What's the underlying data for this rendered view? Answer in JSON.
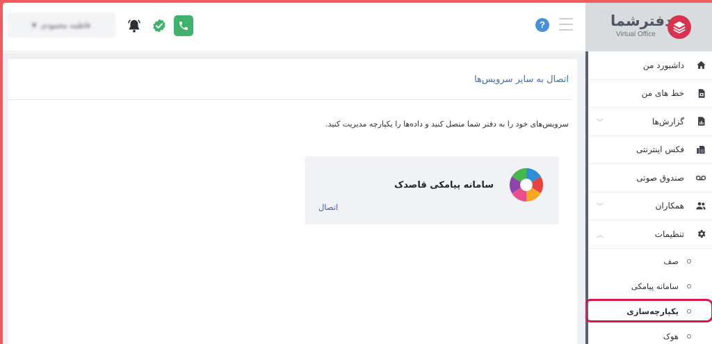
{
  "header": {
    "user_select_value": "فاطمه محمودی",
    "icons": [
      "bell-icon",
      "verified-check-icon",
      "phone-icon",
      "help-icon",
      "menu-icon"
    ]
  },
  "brand": {
    "name": "دفترشما",
    "subtitle": "Virtual Office"
  },
  "sidebar": {
    "items": [
      {
        "label": "داشبورد من",
        "icon": "home-icon"
      },
      {
        "label": "خط های من",
        "icon": "sim-icon"
      },
      {
        "label": "گزارش‌ها",
        "icon": "report-icon"
      },
      {
        "label": "فکس اینترنتی",
        "icon": "fax-icon"
      },
      {
        "label": "صندوق صوتی",
        "icon": "voicemail-icon"
      },
      {
        "label": "همکاران",
        "icon": "users-icon"
      },
      {
        "label": "تنظیمات",
        "icon": "gear-icon"
      }
    ],
    "subitems": [
      {
        "label": "صف"
      },
      {
        "label": "سامانه پیامکی"
      },
      {
        "label": "یکپارچه‌سازی"
      },
      {
        "label": "هوک"
      }
    ]
  },
  "main": {
    "title": "اتصال به سایر سرویس‌ها",
    "description": "سرویس‌های خود را به دفتر شما متصل کنید و داده‌ها را یکپارچه مدیریت کنید.",
    "service": {
      "name": "سامانه پیامکی قاصدک",
      "connect_label": "اتصال",
      "icon": "ghasedak-logo"
    }
  },
  "colors": {
    "accent_green": "#3fb36b",
    "link_blue": "#3d6ea8",
    "brand_red": "#d7334f",
    "highlight": "#d4184a"
  }
}
